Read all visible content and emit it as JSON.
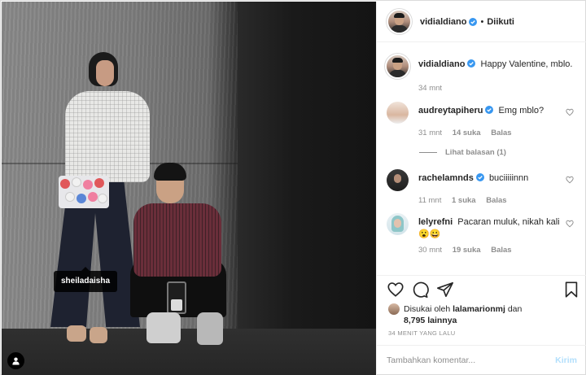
{
  "photo": {
    "tag_username": "sheiladaisha",
    "tags_icon": "person-tag-icon"
  },
  "header": {
    "username": "vidialdiano",
    "separator": "•",
    "follow_status": "Diikuti"
  },
  "caption": {
    "username": "vidialdiano",
    "text": "Happy Valentine, mblo.",
    "time": "34 mnt"
  },
  "comments": [
    {
      "username": "audreytapiheru",
      "text": "Emg mblo?",
      "time": "31 mnt",
      "likes": "14 suka",
      "reply": "Balas",
      "verified": true
    },
    {
      "username": "rachelamnds",
      "text": "buciiiiinnn",
      "time": "11 mnt",
      "likes": "1 suka",
      "reply": "Balas",
      "verified": true
    },
    {
      "username": "lelyrefni",
      "text": "Pacaran muluk, nikah kali",
      "emoji": "😮😀",
      "time": "30 mnt",
      "likes": "19 suka",
      "reply": "Balas",
      "verified": false
    }
  ],
  "view_replies": "Lihat balasan (1)",
  "likes": {
    "prefix": "Disukai oleh",
    "user": "lalamarionmj",
    "joiner": "dan",
    "count": "8,795 lainnya"
  },
  "timestamp": "34 MENIT YANG LALU",
  "add_comment": {
    "placeholder": "Tambahkan komentar...",
    "post_label": "Kirim"
  },
  "colors": {
    "verified": "#3897f0",
    "muted": "#8e8e8e",
    "post_disabled": "#b2dffc"
  }
}
